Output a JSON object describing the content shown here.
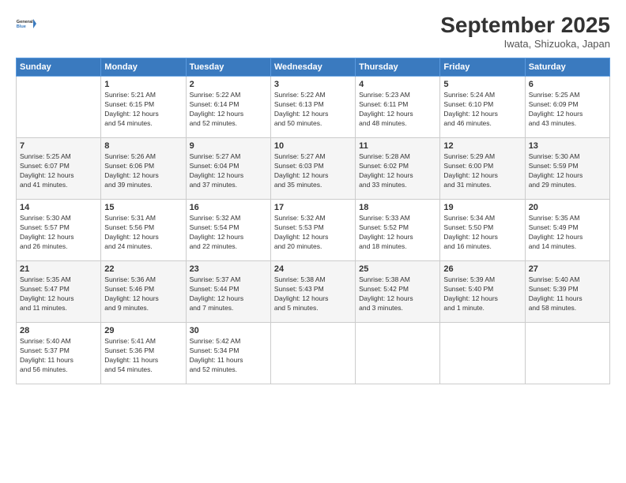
{
  "header": {
    "logo_line1": "General",
    "logo_line2": "Blue",
    "month": "September 2025",
    "location": "Iwata, Shizuoka, Japan"
  },
  "weekdays": [
    "Sunday",
    "Monday",
    "Tuesday",
    "Wednesday",
    "Thursday",
    "Friday",
    "Saturday"
  ],
  "weeks": [
    [
      {
        "day": "",
        "info": ""
      },
      {
        "day": "1",
        "info": "Sunrise: 5:21 AM\nSunset: 6:15 PM\nDaylight: 12 hours\nand 54 minutes."
      },
      {
        "day": "2",
        "info": "Sunrise: 5:22 AM\nSunset: 6:14 PM\nDaylight: 12 hours\nand 52 minutes."
      },
      {
        "day": "3",
        "info": "Sunrise: 5:22 AM\nSunset: 6:13 PM\nDaylight: 12 hours\nand 50 minutes."
      },
      {
        "day": "4",
        "info": "Sunrise: 5:23 AM\nSunset: 6:11 PM\nDaylight: 12 hours\nand 48 minutes."
      },
      {
        "day": "5",
        "info": "Sunrise: 5:24 AM\nSunset: 6:10 PM\nDaylight: 12 hours\nand 46 minutes."
      },
      {
        "day": "6",
        "info": "Sunrise: 5:25 AM\nSunset: 6:09 PM\nDaylight: 12 hours\nand 43 minutes."
      }
    ],
    [
      {
        "day": "7",
        "info": "Sunrise: 5:25 AM\nSunset: 6:07 PM\nDaylight: 12 hours\nand 41 minutes."
      },
      {
        "day": "8",
        "info": "Sunrise: 5:26 AM\nSunset: 6:06 PM\nDaylight: 12 hours\nand 39 minutes."
      },
      {
        "day": "9",
        "info": "Sunrise: 5:27 AM\nSunset: 6:04 PM\nDaylight: 12 hours\nand 37 minutes."
      },
      {
        "day": "10",
        "info": "Sunrise: 5:27 AM\nSunset: 6:03 PM\nDaylight: 12 hours\nand 35 minutes."
      },
      {
        "day": "11",
        "info": "Sunrise: 5:28 AM\nSunset: 6:02 PM\nDaylight: 12 hours\nand 33 minutes."
      },
      {
        "day": "12",
        "info": "Sunrise: 5:29 AM\nSunset: 6:00 PM\nDaylight: 12 hours\nand 31 minutes."
      },
      {
        "day": "13",
        "info": "Sunrise: 5:30 AM\nSunset: 5:59 PM\nDaylight: 12 hours\nand 29 minutes."
      }
    ],
    [
      {
        "day": "14",
        "info": "Sunrise: 5:30 AM\nSunset: 5:57 PM\nDaylight: 12 hours\nand 26 minutes."
      },
      {
        "day": "15",
        "info": "Sunrise: 5:31 AM\nSunset: 5:56 PM\nDaylight: 12 hours\nand 24 minutes."
      },
      {
        "day": "16",
        "info": "Sunrise: 5:32 AM\nSunset: 5:54 PM\nDaylight: 12 hours\nand 22 minutes."
      },
      {
        "day": "17",
        "info": "Sunrise: 5:32 AM\nSunset: 5:53 PM\nDaylight: 12 hours\nand 20 minutes."
      },
      {
        "day": "18",
        "info": "Sunrise: 5:33 AM\nSunset: 5:52 PM\nDaylight: 12 hours\nand 18 minutes."
      },
      {
        "day": "19",
        "info": "Sunrise: 5:34 AM\nSunset: 5:50 PM\nDaylight: 12 hours\nand 16 minutes."
      },
      {
        "day": "20",
        "info": "Sunrise: 5:35 AM\nSunset: 5:49 PM\nDaylight: 12 hours\nand 14 minutes."
      }
    ],
    [
      {
        "day": "21",
        "info": "Sunrise: 5:35 AM\nSunset: 5:47 PM\nDaylight: 12 hours\nand 11 minutes."
      },
      {
        "day": "22",
        "info": "Sunrise: 5:36 AM\nSunset: 5:46 PM\nDaylight: 12 hours\nand 9 minutes."
      },
      {
        "day": "23",
        "info": "Sunrise: 5:37 AM\nSunset: 5:44 PM\nDaylight: 12 hours\nand 7 minutes."
      },
      {
        "day": "24",
        "info": "Sunrise: 5:38 AM\nSunset: 5:43 PM\nDaylight: 12 hours\nand 5 minutes."
      },
      {
        "day": "25",
        "info": "Sunrise: 5:38 AM\nSunset: 5:42 PM\nDaylight: 12 hours\nand 3 minutes."
      },
      {
        "day": "26",
        "info": "Sunrise: 5:39 AM\nSunset: 5:40 PM\nDaylight: 12 hours\nand 1 minute."
      },
      {
        "day": "27",
        "info": "Sunrise: 5:40 AM\nSunset: 5:39 PM\nDaylight: 11 hours\nand 58 minutes."
      }
    ],
    [
      {
        "day": "28",
        "info": "Sunrise: 5:40 AM\nSunset: 5:37 PM\nDaylight: 11 hours\nand 56 minutes."
      },
      {
        "day": "29",
        "info": "Sunrise: 5:41 AM\nSunset: 5:36 PM\nDaylight: 11 hours\nand 54 minutes."
      },
      {
        "day": "30",
        "info": "Sunrise: 5:42 AM\nSunset: 5:34 PM\nDaylight: 11 hours\nand 52 minutes."
      },
      {
        "day": "",
        "info": ""
      },
      {
        "day": "",
        "info": ""
      },
      {
        "day": "",
        "info": ""
      },
      {
        "day": "",
        "info": ""
      }
    ]
  ]
}
